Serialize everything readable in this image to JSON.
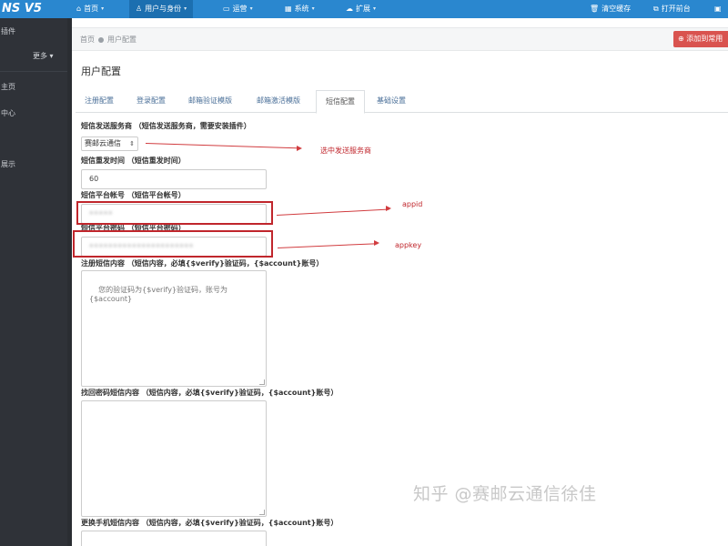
{
  "navbar": {
    "brand": "NS V5",
    "items": [
      {
        "icon": "home-icon",
        "glyph": "⌂",
        "label": "首页",
        "caret": "▾"
      },
      {
        "icon": "user-icon",
        "glyph": "♙",
        "label": "用户与身份",
        "caret": "▾"
      },
      {
        "icon": "desktop-icon",
        "glyph": "▭",
        "label": "运营",
        "caret": "▾"
      },
      {
        "icon": "windows-icon",
        "glyph": "▦",
        "label": "系统",
        "caret": "▾"
      },
      {
        "icon": "cloud-icon",
        "glyph": "☁",
        "label": "扩展",
        "caret": "▾"
      }
    ],
    "right": [
      {
        "icon": "trash-icon",
        "glyph": "🗑",
        "label": "清空缓存"
      },
      {
        "icon": "copy-icon",
        "glyph": "⧉",
        "label": "打开前台"
      },
      {
        "icon": "avatar-icon",
        "glyph": "▣",
        "label": ""
      }
    ]
  },
  "sidebar": {
    "items": [
      {
        "label": "插件"
      },
      {
        "label": "主页"
      },
      {
        "label": "中心"
      },
      {
        "label": ""
      },
      {
        "label": "展示"
      }
    ],
    "more_label": "更多 ▾"
  },
  "breadcrumb": {
    "home": "首页",
    "current": "用户配置"
  },
  "add_common_label": "⊕ 添加到常用",
  "page_title": "用户配置",
  "tabs": [
    {
      "label": "注册配置"
    },
    {
      "label": "登录配置"
    },
    {
      "label": "邮箱验证模版"
    },
    {
      "label": "邮箱激活模版"
    },
    {
      "label": "短信配置"
    },
    {
      "label": "基础设置"
    }
  ],
  "form": {
    "provider_label": "短信发送服务商",
    "provider_hint": "（短信发送服务商，需要安装插件）",
    "provider_value": "赛邮云通信",
    "resend_label": "短信重发时间",
    "resend_hint": "（短信重发时间）",
    "resend_value": "60",
    "account_label": "短信平台帐号",
    "account_hint": "（短信平台帐号）",
    "account_value": "•••••",
    "password_label": "短信平台密码",
    "password_hint": "（短信平台密码）",
    "password_value": "••••••••••••••••••••••",
    "reg_label": "注册短信内容",
    "reg_hint": "（短信内容，必填{$verify}验证码，{$account}账号）",
    "reg_value": "您的验证码为{$verify}验证码，账号为{$account}",
    "findpwd_label": "找回密码短信内容",
    "findpwd_hint": "（短信内容，必填{$verify}验证码，{$account}账号）",
    "findpwd_value": "",
    "change_label": "更换手机短信内容",
    "change_hint": "（短信内容，必填{$verify}验证码，{$account}账号）",
    "change_value": ""
  },
  "annotations": {
    "provider_note": "选中发送服务商",
    "appid_note": "appid",
    "appkey_note": "appkey",
    "color": "#c0262c"
  },
  "watermark": "知乎 @赛邮云通信徐佳",
  "colors": {
    "navbar": "#2a87cf",
    "sidebar": "#2f3238",
    "accent_red": "#d9534f"
  }
}
